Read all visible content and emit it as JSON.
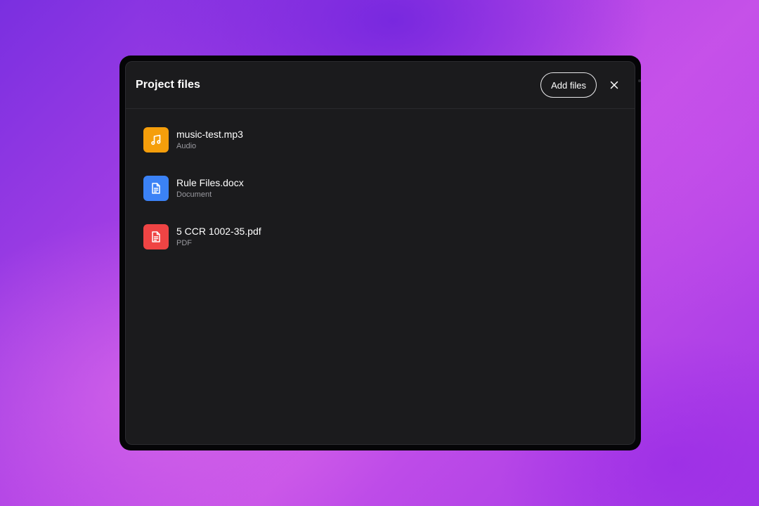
{
  "dialog": {
    "title": "Project files",
    "add_label": "Add files"
  },
  "colors": {
    "audio": "#f59e0b",
    "document": "#3b82f6",
    "pdf": "#ef4444",
    "panel": "#1b1b1d"
  },
  "files": [
    {
      "name": "music-test.mp3",
      "type": "Audio",
      "icon": "music-note-icon"
    },
    {
      "name": "Rule Files.docx",
      "type": "Document",
      "icon": "document-icon"
    },
    {
      "name": "5 CCR 1002-35.pdf",
      "type": "PDF",
      "icon": "document-icon"
    }
  ]
}
